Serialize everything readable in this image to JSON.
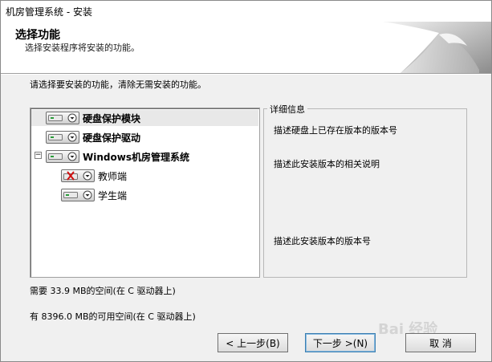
{
  "window": {
    "title": "机房管理系统 - 安装"
  },
  "header": {
    "title": "选择功能",
    "subtitle": "选择安装程序将安装的功能。"
  },
  "instruction": "请选择要安装的功能，清除无需安装的功能。",
  "tree": {
    "items": [
      {
        "label": "硬盘保护模块",
        "state": "install",
        "bold": true
      },
      {
        "label": "硬盘保护驱动",
        "state": "install",
        "bold": true
      },
      {
        "label": "Windows机房管理系统",
        "state": "install",
        "bold": true,
        "expander": "−"
      },
      {
        "label": "教师端",
        "state": "excluded",
        "bold": false
      },
      {
        "label": "学生端",
        "state": "install",
        "bold": false
      }
    ]
  },
  "info": {
    "legend": "详细信息",
    "line1": "描述硬盘上已存在版本的版本号",
    "line2": "描述此安装版本的相关说明",
    "line3": "描述此安装版本的版本号"
  },
  "space": {
    "required": "需要 33.9 MB的空间(在 C 驱动器上)",
    "available": "有 8396.0 MB的可用空间(在 C 驱动器上)"
  },
  "buttons": {
    "back": "< 上一步(B)",
    "next": "下一步 >(N)",
    "cancel": "取 消"
  },
  "watermark": "Bai 经验",
  "colors": {
    "excluded": "#d01010",
    "selection": "#e8e8e8"
  }
}
